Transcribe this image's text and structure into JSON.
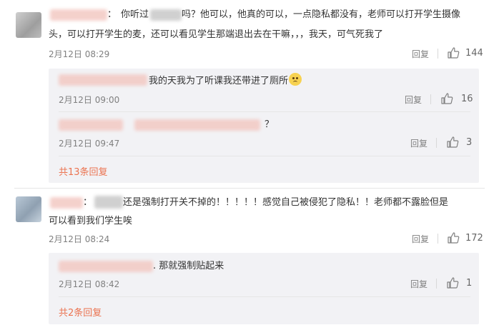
{
  "comments": [
    {
      "name_suffix": "：",
      "text_line1_a": "你听过",
      "text_line1_b": "吗？他可以，他真的可以，一点隐私都没有，老师可以打开学生摄像",
      "text_line2": "头，可以打开学生的麦，还可以看见学生那端退出去在干嘛，，，我天，可气死我了",
      "time": "2月12日 08:29",
      "reply_label": "回复",
      "likes": "144",
      "replies": [
        {
          "text": "我的天我为了听课我还带进了厕所",
          "emoji": "sad-face",
          "time": "2月12日 09:00",
          "reply_label": "回复",
          "likes": "16"
        },
        {
          "text": "？",
          "time": "2月12日 09:47",
          "reply_label": "回复",
          "likes": "3"
        }
      ],
      "more_label": "共13条回复"
    },
    {
      "name_suffix": "：",
      "text_line1": "还是强制打开关不掉的！！！！！感觉自己被侵犯了隐私！！老师都不露脸但是",
      "text_line2": "可以看到我们学生唉",
      "time": "2月12日 08:24",
      "reply_label": "回复",
      "likes": "172",
      "replies": [
        {
          "text": ". 那就强制贴起来",
          "time": "2月12日 08:42",
          "reply_label": "回复",
          "likes": "1"
        }
      ],
      "more_label": "共2条回复"
    }
  ],
  "colors": {
    "link": "#eb7350",
    "meta": "#808080",
    "reply_bg": "#f2f2f5"
  }
}
